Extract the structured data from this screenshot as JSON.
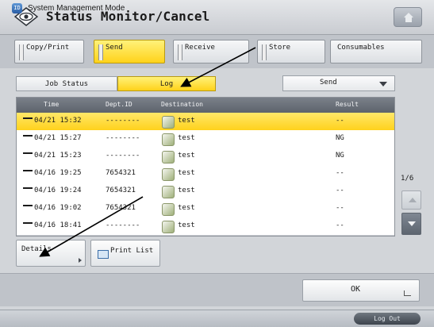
{
  "window": {
    "title": "Status Monitor/Cancel"
  },
  "category_tabs": [
    {
      "label": "Copy/Print",
      "active": false
    },
    {
      "label": "Send",
      "active": true
    },
    {
      "label": "Receive",
      "active": false
    },
    {
      "label": "Store",
      "active": false
    },
    {
      "label": "Consumables",
      "active": false
    }
  ],
  "sub_tabs": [
    {
      "label": "Job Status",
      "active": false
    },
    {
      "label": "Log",
      "active": true
    }
  ],
  "filter_select": {
    "value": "Send"
  },
  "table": {
    "headers": [
      "Time",
      "Dept.ID",
      "Destination",
      "Result"
    ],
    "rows": [
      {
        "time": "04/21 15:32",
        "dept": "--------",
        "dest": "test",
        "result": "--",
        "selected": true
      },
      {
        "time": "04/21 15:27",
        "dept": "--------",
        "dest": "test",
        "result": "NG",
        "selected": false
      },
      {
        "time": "04/21 15:23",
        "dept": "--------",
        "dest": "test",
        "result": "NG",
        "selected": false
      },
      {
        "time": "04/16 19:25",
        "dept": "7654321",
        "dest": "test",
        "result": "--",
        "selected": false
      },
      {
        "time": "04/16 19:24",
        "dept": "7654321",
        "dest": "test",
        "result": "--",
        "selected": false
      },
      {
        "time": "04/16 19:02",
        "dept": "7654321",
        "dest": "test",
        "result": "--",
        "selected": false
      },
      {
        "time": "04/16 18:41",
        "dept": "--------",
        "dest": "test",
        "result": "--",
        "selected": false
      }
    ]
  },
  "pagination": {
    "label": "1/6"
  },
  "buttons": {
    "details": "Details",
    "print_list": "Print List",
    "ok": "OK"
  },
  "status_bar": {
    "mode_text": "System Management Mode",
    "logout": "Log Out"
  },
  "colors": {
    "accent_yellow": "#ffd21a",
    "header_gray": "#5d636c"
  },
  "icons": {
    "title": "status-monitor-icon",
    "home": "home-icon",
    "destination": "address-book-icon"
  }
}
